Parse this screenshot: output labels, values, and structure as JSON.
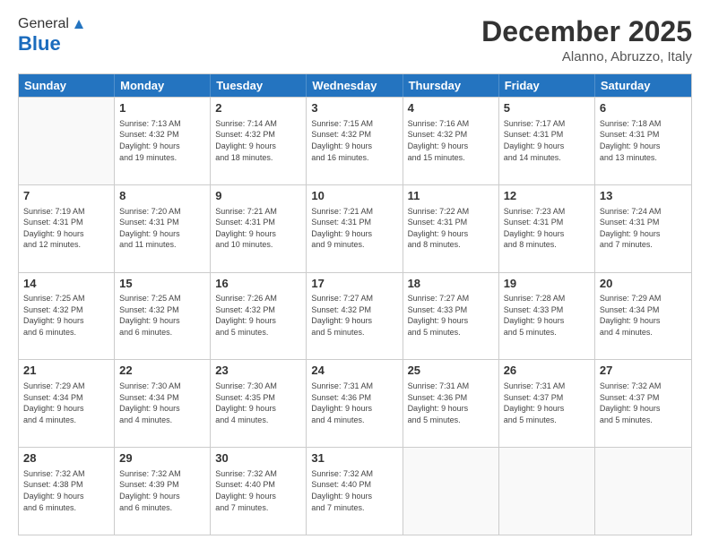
{
  "logo": {
    "general": "General",
    "blue": "Blue"
  },
  "header": {
    "month": "December 2025",
    "location": "Alanno, Abruzzo, Italy"
  },
  "days": [
    "Sunday",
    "Monday",
    "Tuesday",
    "Wednesday",
    "Thursday",
    "Friday",
    "Saturday"
  ],
  "rows": [
    [
      {
        "day": "",
        "info": ""
      },
      {
        "day": "1",
        "info": "Sunrise: 7:13 AM\nSunset: 4:32 PM\nDaylight: 9 hours\nand 19 minutes."
      },
      {
        "day": "2",
        "info": "Sunrise: 7:14 AM\nSunset: 4:32 PM\nDaylight: 9 hours\nand 18 minutes."
      },
      {
        "day": "3",
        "info": "Sunrise: 7:15 AM\nSunset: 4:32 PM\nDaylight: 9 hours\nand 16 minutes."
      },
      {
        "day": "4",
        "info": "Sunrise: 7:16 AM\nSunset: 4:32 PM\nDaylight: 9 hours\nand 15 minutes."
      },
      {
        "day": "5",
        "info": "Sunrise: 7:17 AM\nSunset: 4:31 PM\nDaylight: 9 hours\nand 14 minutes."
      },
      {
        "day": "6",
        "info": "Sunrise: 7:18 AM\nSunset: 4:31 PM\nDaylight: 9 hours\nand 13 minutes."
      }
    ],
    [
      {
        "day": "7",
        "info": "Sunrise: 7:19 AM\nSunset: 4:31 PM\nDaylight: 9 hours\nand 12 minutes."
      },
      {
        "day": "8",
        "info": "Sunrise: 7:20 AM\nSunset: 4:31 PM\nDaylight: 9 hours\nand 11 minutes."
      },
      {
        "day": "9",
        "info": "Sunrise: 7:21 AM\nSunset: 4:31 PM\nDaylight: 9 hours\nand 10 minutes."
      },
      {
        "day": "10",
        "info": "Sunrise: 7:21 AM\nSunset: 4:31 PM\nDaylight: 9 hours\nand 9 minutes."
      },
      {
        "day": "11",
        "info": "Sunrise: 7:22 AM\nSunset: 4:31 PM\nDaylight: 9 hours\nand 8 minutes."
      },
      {
        "day": "12",
        "info": "Sunrise: 7:23 AM\nSunset: 4:31 PM\nDaylight: 9 hours\nand 8 minutes."
      },
      {
        "day": "13",
        "info": "Sunrise: 7:24 AM\nSunset: 4:31 PM\nDaylight: 9 hours\nand 7 minutes."
      }
    ],
    [
      {
        "day": "14",
        "info": "Sunrise: 7:25 AM\nSunset: 4:32 PM\nDaylight: 9 hours\nand 6 minutes."
      },
      {
        "day": "15",
        "info": "Sunrise: 7:25 AM\nSunset: 4:32 PM\nDaylight: 9 hours\nand 6 minutes."
      },
      {
        "day": "16",
        "info": "Sunrise: 7:26 AM\nSunset: 4:32 PM\nDaylight: 9 hours\nand 5 minutes."
      },
      {
        "day": "17",
        "info": "Sunrise: 7:27 AM\nSunset: 4:32 PM\nDaylight: 9 hours\nand 5 minutes."
      },
      {
        "day": "18",
        "info": "Sunrise: 7:27 AM\nSunset: 4:33 PM\nDaylight: 9 hours\nand 5 minutes."
      },
      {
        "day": "19",
        "info": "Sunrise: 7:28 AM\nSunset: 4:33 PM\nDaylight: 9 hours\nand 5 minutes."
      },
      {
        "day": "20",
        "info": "Sunrise: 7:29 AM\nSunset: 4:34 PM\nDaylight: 9 hours\nand 4 minutes."
      }
    ],
    [
      {
        "day": "21",
        "info": "Sunrise: 7:29 AM\nSunset: 4:34 PM\nDaylight: 9 hours\nand 4 minutes."
      },
      {
        "day": "22",
        "info": "Sunrise: 7:30 AM\nSunset: 4:34 PM\nDaylight: 9 hours\nand 4 minutes."
      },
      {
        "day": "23",
        "info": "Sunrise: 7:30 AM\nSunset: 4:35 PM\nDaylight: 9 hours\nand 4 minutes."
      },
      {
        "day": "24",
        "info": "Sunrise: 7:31 AM\nSunset: 4:36 PM\nDaylight: 9 hours\nand 4 minutes."
      },
      {
        "day": "25",
        "info": "Sunrise: 7:31 AM\nSunset: 4:36 PM\nDaylight: 9 hours\nand 5 minutes."
      },
      {
        "day": "26",
        "info": "Sunrise: 7:31 AM\nSunset: 4:37 PM\nDaylight: 9 hours\nand 5 minutes."
      },
      {
        "day": "27",
        "info": "Sunrise: 7:32 AM\nSunset: 4:37 PM\nDaylight: 9 hours\nand 5 minutes."
      }
    ],
    [
      {
        "day": "28",
        "info": "Sunrise: 7:32 AM\nSunset: 4:38 PM\nDaylight: 9 hours\nand 6 minutes."
      },
      {
        "day": "29",
        "info": "Sunrise: 7:32 AM\nSunset: 4:39 PM\nDaylight: 9 hours\nand 6 minutes."
      },
      {
        "day": "30",
        "info": "Sunrise: 7:32 AM\nSunset: 4:40 PM\nDaylight: 9 hours\nand 7 minutes."
      },
      {
        "day": "31",
        "info": "Sunrise: 7:32 AM\nSunset: 4:40 PM\nDaylight: 9 hours\nand 7 minutes."
      },
      {
        "day": "",
        "info": ""
      },
      {
        "day": "",
        "info": ""
      },
      {
        "day": "",
        "info": ""
      }
    ]
  ]
}
